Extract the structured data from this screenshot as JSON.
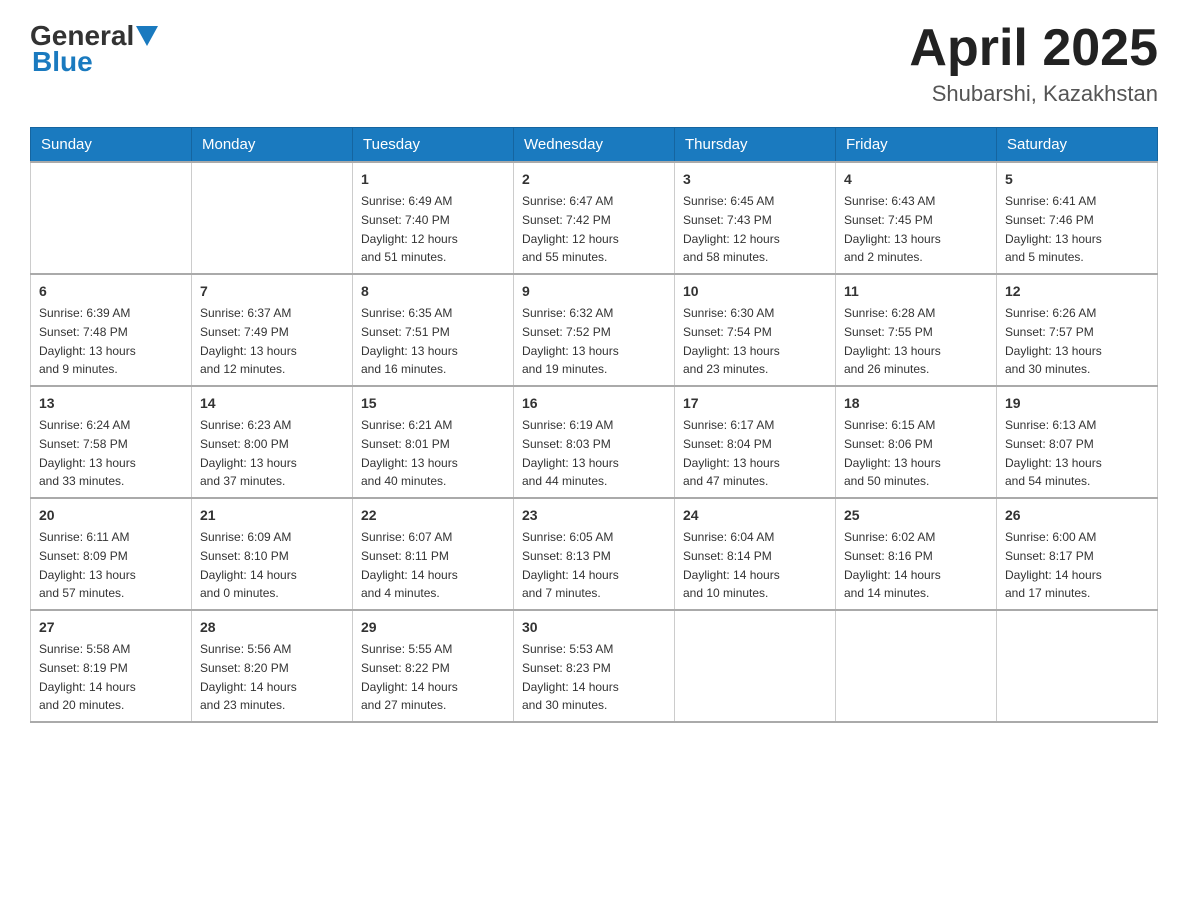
{
  "header": {
    "logo": {
      "general": "General",
      "blue": "Blue"
    },
    "title": "April 2025",
    "subtitle": "Shubarshi, Kazakhstan"
  },
  "weekdays": [
    "Sunday",
    "Monday",
    "Tuesday",
    "Wednesday",
    "Thursday",
    "Friday",
    "Saturday"
  ],
  "weeks": [
    [
      {
        "day": "",
        "info": ""
      },
      {
        "day": "",
        "info": ""
      },
      {
        "day": "1",
        "info": "Sunrise: 6:49 AM\nSunset: 7:40 PM\nDaylight: 12 hours\nand 51 minutes."
      },
      {
        "day": "2",
        "info": "Sunrise: 6:47 AM\nSunset: 7:42 PM\nDaylight: 12 hours\nand 55 minutes."
      },
      {
        "day": "3",
        "info": "Sunrise: 6:45 AM\nSunset: 7:43 PM\nDaylight: 12 hours\nand 58 minutes."
      },
      {
        "day": "4",
        "info": "Sunrise: 6:43 AM\nSunset: 7:45 PM\nDaylight: 13 hours\nand 2 minutes."
      },
      {
        "day": "5",
        "info": "Sunrise: 6:41 AM\nSunset: 7:46 PM\nDaylight: 13 hours\nand 5 minutes."
      }
    ],
    [
      {
        "day": "6",
        "info": "Sunrise: 6:39 AM\nSunset: 7:48 PM\nDaylight: 13 hours\nand 9 minutes."
      },
      {
        "day": "7",
        "info": "Sunrise: 6:37 AM\nSunset: 7:49 PM\nDaylight: 13 hours\nand 12 minutes."
      },
      {
        "day": "8",
        "info": "Sunrise: 6:35 AM\nSunset: 7:51 PM\nDaylight: 13 hours\nand 16 minutes."
      },
      {
        "day": "9",
        "info": "Sunrise: 6:32 AM\nSunset: 7:52 PM\nDaylight: 13 hours\nand 19 minutes."
      },
      {
        "day": "10",
        "info": "Sunrise: 6:30 AM\nSunset: 7:54 PM\nDaylight: 13 hours\nand 23 minutes."
      },
      {
        "day": "11",
        "info": "Sunrise: 6:28 AM\nSunset: 7:55 PM\nDaylight: 13 hours\nand 26 minutes."
      },
      {
        "day": "12",
        "info": "Sunrise: 6:26 AM\nSunset: 7:57 PM\nDaylight: 13 hours\nand 30 minutes."
      }
    ],
    [
      {
        "day": "13",
        "info": "Sunrise: 6:24 AM\nSunset: 7:58 PM\nDaylight: 13 hours\nand 33 minutes."
      },
      {
        "day": "14",
        "info": "Sunrise: 6:23 AM\nSunset: 8:00 PM\nDaylight: 13 hours\nand 37 minutes."
      },
      {
        "day": "15",
        "info": "Sunrise: 6:21 AM\nSunset: 8:01 PM\nDaylight: 13 hours\nand 40 minutes."
      },
      {
        "day": "16",
        "info": "Sunrise: 6:19 AM\nSunset: 8:03 PM\nDaylight: 13 hours\nand 44 minutes."
      },
      {
        "day": "17",
        "info": "Sunrise: 6:17 AM\nSunset: 8:04 PM\nDaylight: 13 hours\nand 47 minutes."
      },
      {
        "day": "18",
        "info": "Sunrise: 6:15 AM\nSunset: 8:06 PM\nDaylight: 13 hours\nand 50 minutes."
      },
      {
        "day": "19",
        "info": "Sunrise: 6:13 AM\nSunset: 8:07 PM\nDaylight: 13 hours\nand 54 minutes."
      }
    ],
    [
      {
        "day": "20",
        "info": "Sunrise: 6:11 AM\nSunset: 8:09 PM\nDaylight: 13 hours\nand 57 minutes."
      },
      {
        "day": "21",
        "info": "Sunrise: 6:09 AM\nSunset: 8:10 PM\nDaylight: 14 hours\nand 0 minutes."
      },
      {
        "day": "22",
        "info": "Sunrise: 6:07 AM\nSunset: 8:11 PM\nDaylight: 14 hours\nand 4 minutes."
      },
      {
        "day": "23",
        "info": "Sunrise: 6:05 AM\nSunset: 8:13 PM\nDaylight: 14 hours\nand 7 minutes."
      },
      {
        "day": "24",
        "info": "Sunrise: 6:04 AM\nSunset: 8:14 PM\nDaylight: 14 hours\nand 10 minutes."
      },
      {
        "day": "25",
        "info": "Sunrise: 6:02 AM\nSunset: 8:16 PM\nDaylight: 14 hours\nand 14 minutes."
      },
      {
        "day": "26",
        "info": "Sunrise: 6:00 AM\nSunset: 8:17 PM\nDaylight: 14 hours\nand 17 minutes."
      }
    ],
    [
      {
        "day": "27",
        "info": "Sunrise: 5:58 AM\nSunset: 8:19 PM\nDaylight: 14 hours\nand 20 minutes."
      },
      {
        "day": "28",
        "info": "Sunrise: 5:56 AM\nSunset: 8:20 PM\nDaylight: 14 hours\nand 23 minutes."
      },
      {
        "day": "29",
        "info": "Sunrise: 5:55 AM\nSunset: 8:22 PM\nDaylight: 14 hours\nand 27 minutes."
      },
      {
        "day": "30",
        "info": "Sunrise: 5:53 AM\nSunset: 8:23 PM\nDaylight: 14 hours\nand 30 minutes."
      },
      {
        "day": "",
        "info": ""
      },
      {
        "day": "",
        "info": ""
      },
      {
        "day": "",
        "info": ""
      }
    ]
  ]
}
